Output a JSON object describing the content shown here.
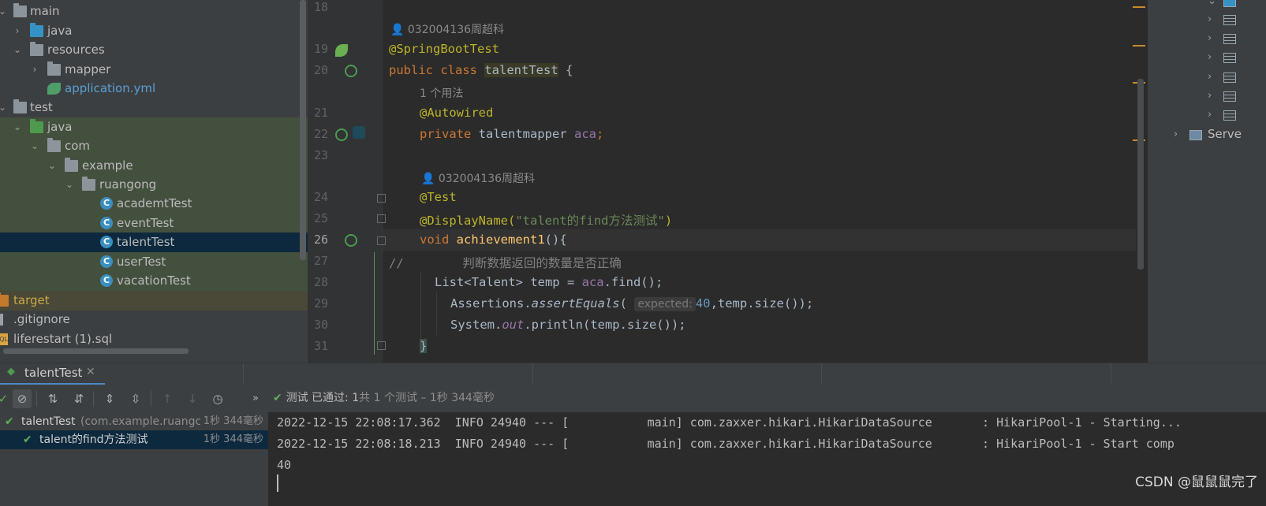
{
  "project_tree": {
    "items": [
      {
        "label": "main",
        "type": "folder"
      },
      {
        "label": "java",
        "type": "source-folder"
      },
      {
        "label": "resources",
        "type": "resources-folder"
      },
      {
        "label": "mapper",
        "type": "folder"
      },
      {
        "label": "application.yml",
        "type": "yaml-file"
      },
      {
        "label": "test",
        "type": "folder"
      },
      {
        "label": "java",
        "type": "test-source-folder"
      },
      {
        "label": "com",
        "type": "package"
      },
      {
        "label": "example",
        "type": "package"
      },
      {
        "label": "ruangong",
        "type": "package"
      },
      {
        "label": "academtTest",
        "type": "class"
      },
      {
        "label": "eventTest",
        "type": "class"
      },
      {
        "label": "talentTest",
        "type": "class",
        "selected": true
      },
      {
        "label": "userTest",
        "type": "class"
      },
      {
        "label": "vacationTest",
        "type": "class"
      },
      {
        "label": "target",
        "type": "excluded-folder"
      },
      {
        "label": ".gitignore",
        "type": "file"
      },
      {
        "label": "liferestart (1).sql",
        "type": "sql-file"
      }
    ]
  },
  "editor": {
    "line_numbers": [
      "18",
      "19",
      "20",
      "21",
      "22",
      "23",
      "24",
      "25",
      "26",
      "27",
      "28",
      "29",
      "30",
      "31"
    ],
    "author_hint_1": "032004136周超科",
    "usages_hint": "1 个用法",
    "author_hint_2": "032004136周超科",
    "lines": {
      "l19_ann": "@SpringBootTest",
      "l20_kw": "public class ",
      "l20_cls": "talentTest",
      "l20_rest": " {",
      "l21_ann": "@Autowired",
      "l22_kw": "private ",
      "l22_type": "talentmapper ",
      "l22_fld": "aca",
      "l22_semi": ";",
      "l24_ann": "@Test",
      "l25_ann": "@DisplayName(",
      "l25_str": "\"talent的find方法测试\"",
      "l25_close": ")",
      "l26_kw": "void ",
      "l26_fn": "achievement1",
      "l26_rest": "(){",
      "l27_comment": "//        判断数据返回的数量是否正确",
      "l28_type": "List<Talent> temp = ",
      "l28_fld": "aca",
      "l28_rest": ".find();",
      "l29_start": "Assertions.",
      "l29_fn": "assertEquals",
      "l29_paren": "(",
      "l29_param_hint": "expected:",
      "l29_num": "40",
      "l29_rest": ",temp.size());",
      "l30_start": "System.",
      "l30_out": "out",
      "l30_rest": ".println(temp.size());",
      "l31": "}"
    }
  },
  "right_panel": {
    "table_count": 6,
    "server_label": "Serve"
  },
  "run_window": {
    "tab_label": "talentTest",
    "status_prefix": "测试 已通过: ",
    "status_count": "1",
    "status_rest": "共 1 个测试 – 1秒 344毫秒",
    "test_tree": [
      {
        "label": "talentTest",
        "sub": " (com.example.ruangc",
        "time": "1秒 344毫秒"
      },
      {
        "label": "talent的find方法测试",
        "time": "1秒 344毫秒"
      }
    ],
    "console": [
      "2022-12-15 22:08:17.362  INFO 24940 --- [           main] com.zaxxer.hikari.HikariDataSource       : HikariPool-1 - Starting...",
      "2022-12-15 22:08:18.213  INFO 24940 --- [           main] com.zaxxer.hikari.HikariDataSource       : HikariPool-1 - Start comp",
      "40"
    ]
  },
  "watermark": "CSDN @鼠鼠鼠完了"
}
